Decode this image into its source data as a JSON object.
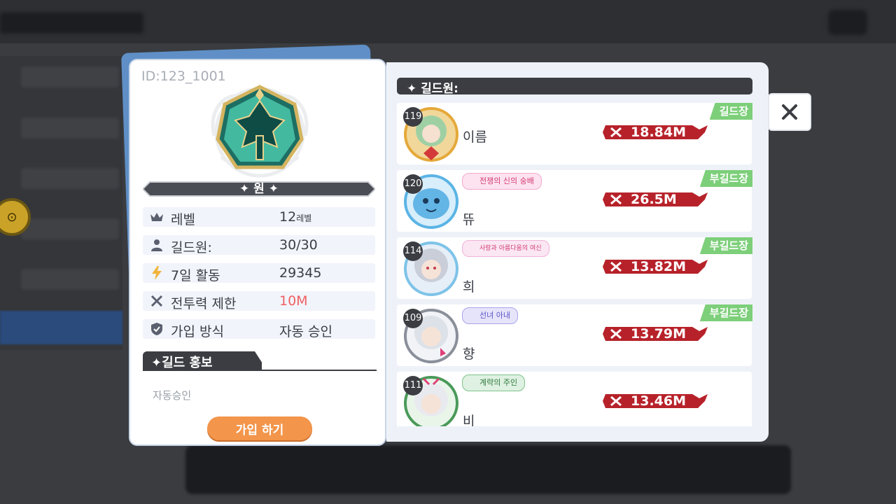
{
  "guild": {
    "id_text": "ID:123_1001",
    "name": "✦ 원 ✦",
    "info": [
      {
        "icon": "crown-icon",
        "label": "레벨",
        "value": "12",
        "unit": "레벨"
      },
      {
        "icon": "person-icon",
        "label": "길드원:",
        "value": "30/30"
      },
      {
        "icon": "lightning-icon",
        "label": "7일 활동",
        "value": "29345"
      },
      {
        "icon": "crossed-swords-icon",
        "label": "전투력 제한",
        "value": "10M"
      },
      {
        "icon": "shield-check-icon",
        "label": "가입 방식",
        "value": "자동 승인"
      }
    ],
    "promo_title": "✦길드 홍보",
    "promo_text": "자동승인",
    "join_button": "가입 하기"
  },
  "members_header": "✦ 길드원:",
  "members": [
    {
      "level": "119",
      "name": "이름",
      "power": "18.84M",
      "role": "길드장",
      "title": ""
    },
    {
      "level": "120",
      "name": "뜌",
      "power": "26.5M",
      "role": "부길드장",
      "title": "전쟁의 신의 숭배"
    },
    {
      "level": "114",
      "name": "희",
      "power": "13.82M",
      "role": "부길드장",
      "title": "사랑과 아름다움의 여신"
    },
    {
      "level": "109",
      "name": "향",
      "power": "13.79M",
      "role": "부길드장",
      "title": "선녀 아내"
    },
    {
      "level": "111",
      "name": "비",
      "power": "13.46M",
      "role": "",
      "title": "계략의 주인"
    }
  ],
  "colors": {
    "accent_orange": "#f3954a",
    "role_green": "#7dcf7a",
    "power_red": "#b7222a",
    "limit_red": "#f06062",
    "dark_bar": "#3b3d42"
  }
}
